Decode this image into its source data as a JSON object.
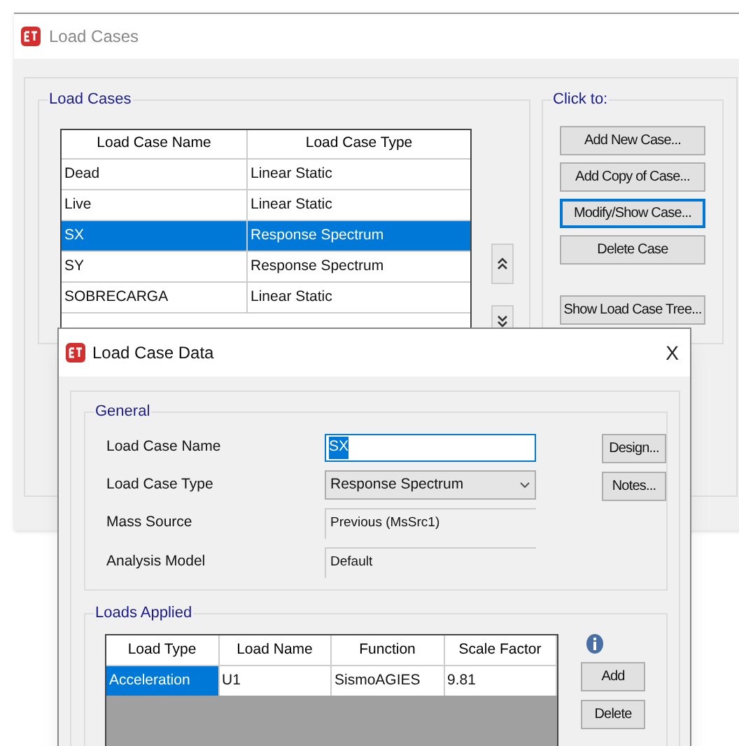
{
  "load_cases_window": {
    "title": "Load Cases",
    "load_cases_group": {
      "label": "Load Cases",
      "table": {
        "columns": [
          "Load Case Name",
          "Load Case Type"
        ],
        "rows": [
          {
            "cells": [
              "Dead",
              "Linear Static"
            ],
            "selected": false
          },
          {
            "cells": [
              "Live",
              "Linear Static"
            ],
            "selected": false
          },
          {
            "cells": [
              "SX",
              "Response Spectrum"
            ],
            "selected": true
          },
          {
            "cells": [
              "SY",
              "Response Spectrum"
            ],
            "selected": false
          },
          {
            "cells": [
              "SOBRECARGA",
              "Linear Static"
            ],
            "selected": false
          }
        ]
      }
    },
    "click_to_group": {
      "label": "Click to:",
      "buttons": [
        {
          "label": "Add New Case...",
          "focused": false
        },
        {
          "label": "Add Copy of Case...",
          "focused": false
        },
        {
          "label": "Modify/Show Case...",
          "focused": true
        },
        {
          "label": "Delete Case",
          "focused": false
        },
        {
          "label": "Show Load Case Tree...",
          "focused": false
        }
      ]
    }
  },
  "load_case_data_dialog": {
    "title": "Load Case Data",
    "close": "X",
    "general_group": {
      "label": "General",
      "fields": [
        {
          "label": "Load Case Name",
          "kind": "input",
          "value": "SX",
          "text_selected": true
        },
        {
          "label": "Load Case Type",
          "kind": "dropdown",
          "value": "Response Spectrum"
        },
        {
          "label": "Mass Source",
          "kind": "readonly",
          "value": "Previous  (MsSrc1)"
        },
        {
          "label": "Analysis Model",
          "kind": "readonly",
          "value": "Default"
        }
      ],
      "buttons": [
        "Design...",
        "Notes..."
      ]
    },
    "loads_applied_group": {
      "label": "Loads Applied",
      "table": {
        "columns": [
          "Load Type",
          "Load Name",
          "Function",
          "Scale Factor"
        ],
        "rows": [
          {
            "cells": [
              {
                "text": "Acceleration",
                "selected": true
              },
              {
                "text": "U1",
                "selected": false
              },
              {
                "text": "SismoAGIES",
                "selected": false
              },
              {
                "text": "9.81",
                "selected": false
              }
            ]
          }
        ]
      },
      "buttons": [
        "Add",
        "Delete"
      ]
    }
  }
}
